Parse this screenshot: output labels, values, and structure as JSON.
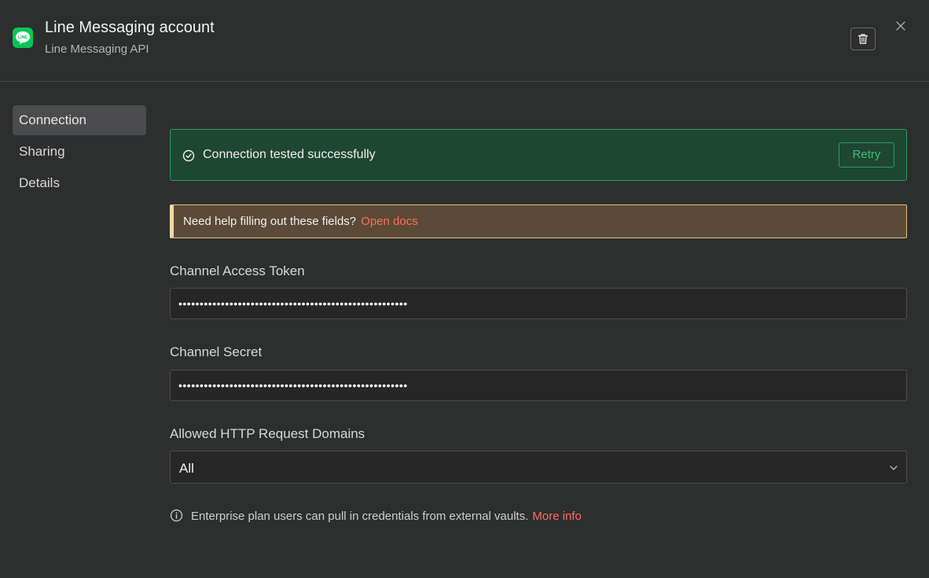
{
  "header": {
    "title": "Line Messaging account",
    "subtitle": "Line Messaging API",
    "app_icon": "line-logo-icon",
    "app_icon_text": "LINE",
    "delete_icon": "trash-icon",
    "close_icon": "close-icon"
  },
  "sidebar": {
    "items": [
      {
        "label": "Connection",
        "active": true
      },
      {
        "label": "Sharing",
        "active": false
      },
      {
        "label": "Details",
        "active": false
      }
    ]
  },
  "status": {
    "icon": "check-circle-icon",
    "text": "Connection tested successfully",
    "retry_label": "Retry"
  },
  "help": {
    "text": "Need help filling out these fields?",
    "link_label": "Open docs"
  },
  "fields": {
    "access_token": {
      "label": "Channel Access Token",
      "value": "••••••••••••••••••••••••••••••••••••••••••••••••••••••"
    },
    "secret": {
      "label": "Channel Secret",
      "value": "••••••••••••••••••••••••••••••••••••••••••••••••••••••"
    },
    "domains": {
      "label": "Allowed HTTP Request Domains",
      "selected": "All",
      "icon": "chevron-down-icon"
    }
  },
  "info": {
    "icon": "info-circle-icon",
    "text": "Enterprise plan users can pull in credentials from external vaults.",
    "link_label": "More info"
  },
  "colors": {
    "background": "#2d2e2e",
    "success_bg": "#1e4732",
    "success_border": "#2e9a5e",
    "warning_bg": "#5a4a37",
    "link": "#ff6d5a",
    "line_brand": "#06c755"
  }
}
